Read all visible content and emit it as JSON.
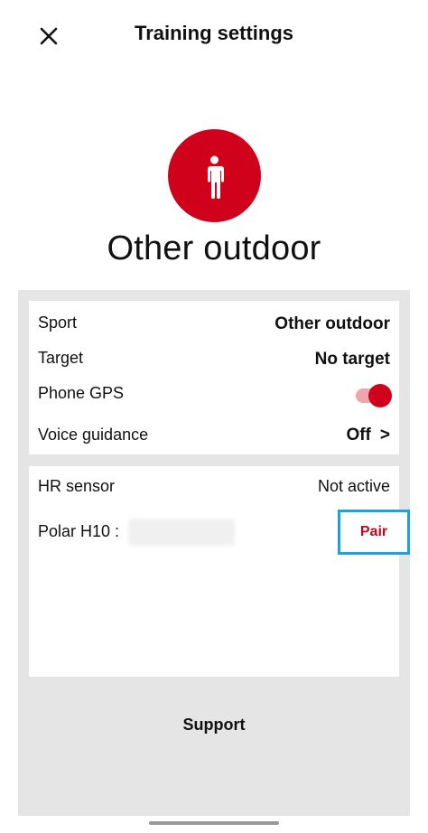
{
  "header": {
    "title": "Training settings",
    "close_icon": "close-icon"
  },
  "hero": {
    "sport_icon": "person-standing-icon",
    "sport_name": "Other outdoor"
  },
  "settings": {
    "sport": {
      "label": "Sport",
      "value": "Other outdoor"
    },
    "target": {
      "label": "Target",
      "value": "No target"
    },
    "phone_gps": {
      "label": "Phone GPS",
      "enabled": true
    },
    "voice_guidance": {
      "label": "Voice guidance",
      "value": "Off",
      "arrow": ">"
    }
  },
  "sensors": {
    "hr_sensor": {
      "label": "HR sensor",
      "status": "Not active"
    },
    "device": {
      "label": "Polar H10 :",
      "action_label": "Pair"
    }
  },
  "footer": {
    "support_label": "Support"
  },
  "colors": {
    "brand_red": "#d0021b",
    "toggle_track": "#f0a4ad",
    "pair_text": "#c0051e",
    "highlight_border": "#1aa3e0",
    "panel_background": "#e5e5e5"
  }
}
